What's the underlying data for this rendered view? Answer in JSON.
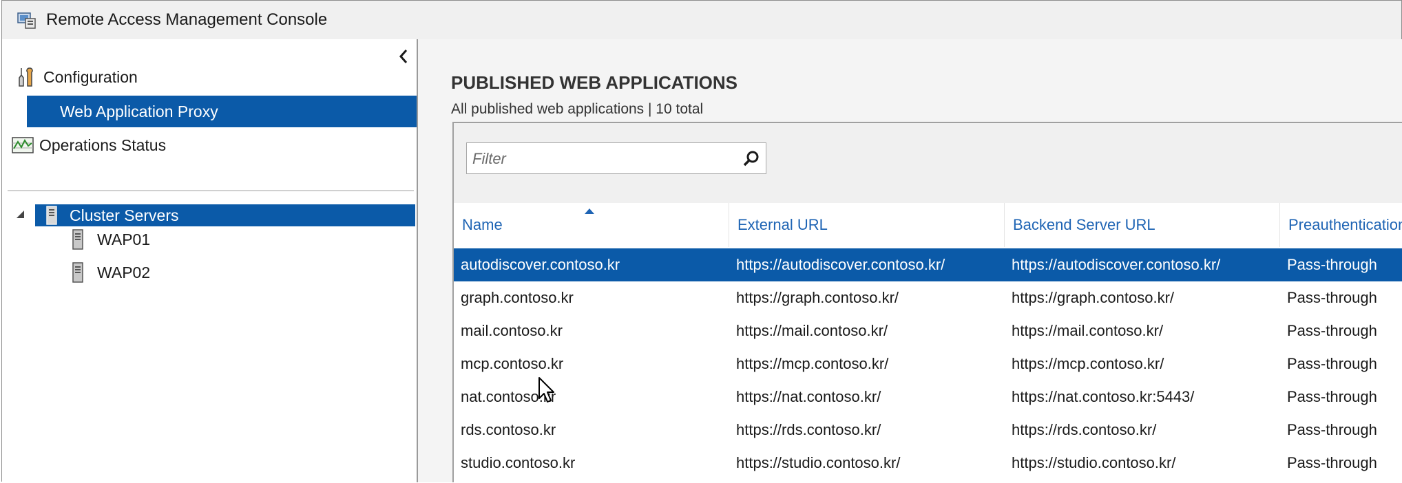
{
  "window": {
    "title": "Remote Access Management Console"
  },
  "nav": {
    "configuration_label": "Configuration",
    "web_app_proxy_label": "Web Application Proxy",
    "operations_status_label": "Operations Status",
    "cluster_servers_label": "Cluster Servers",
    "servers": [
      "WAP01",
      "WAP02"
    ]
  },
  "main": {
    "heading": "PUBLISHED WEB APPLICATIONS",
    "subheading": "All published web applications | 10 total",
    "filter_placeholder": "Filter",
    "columns": [
      "Name",
      "External URL",
      "Backend Server URL",
      "Preauthentication"
    ],
    "rows": [
      {
        "name": "autodiscover.contoso.kr",
        "external": "https://autodiscover.contoso.kr/",
        "backend": "https://autodiscover.contoso.kr/",
        "preauth": "Pass-through",
        "selected": true
      },
      {
        "name": "graph.contoso.kr",
        "external": "https://graph.contoso.kr/",
        "backend": "https://graph.contoso.kr/",
        "preauth": "Pass-through"
      },
      {
        "name": "mail.contoso.kr",
        "external": "https://mail.contoso.kr/",
        "backend": "https://mail.contoso.kr/",
        "preauth": "Pass-through"
      },
      {
        "name": "mcp.contoso.kr",
        "external": "https://mcp.contoso.kr/",
        "backend": "https://mcp.contoso.kr/",
        "preauth": "Pass-through"
      },
      {
        "name": "nat.contoso.kr",
        "external": "https://nat.contoso.kr/",
        "backend": "https://nat.contoso.kr:5443/",
        "preauth": "Pass-through"
      },
      {
        "name": "rds.contoso.kr",
        "external": "https://rds.contoso.kr/",
        "backend": "https://rds.contoso.kr/",
        "preauth": "Pass-through"
      },
      {
        "name": "studio.contoso.kr",
        "external": "https://studio.contoso.kr/",
        "backend": "https://studio.contoso.kr/",
        "preauth": "Pass-through"
      }
    ]
  },
  "colors": {
    "selection": "#0b5aa8",
    "header_text": "#1e64b4",
    "pane_background": "#f4f4f4"
  }
}
